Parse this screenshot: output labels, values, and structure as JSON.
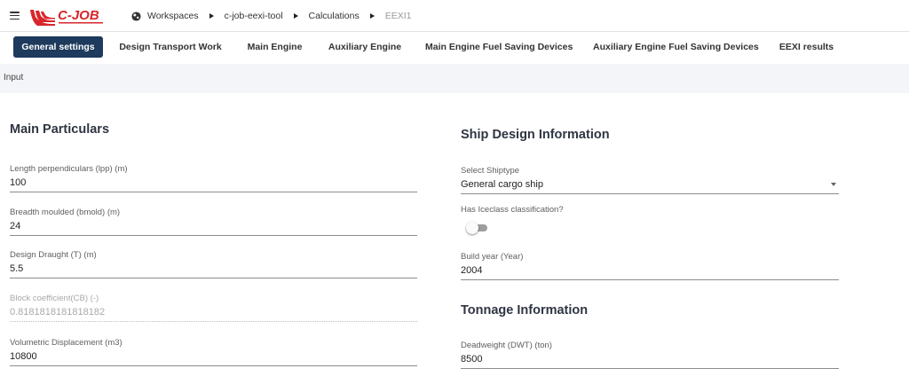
{
  "colors": {
    "tab_active_bg": "#1e3a5c",
    "logo_red": "#d7262b",
    "input_bar_bg": "#f4f5f8"
  },
  "header": {
    "menu_icon": "hamburger-icon",
    "logo_text": "C-JOB",
    "breadcrumb": {
      "workspace_icon": "globe-icon",
      "items": [
        "Workspaces",
        "c-job-eexi-tool",
        "Calculations",
        "EEXI1"
      ]
    }
  },
  "tabs": [
    {
      "label": "General settings",
      "active": true
    },
    {
      "label": "Design Transport Work",
      "active": false
    },
    {
      "label": "Main Engine",
      "active": false
    },
    {
      "label": "Auxiliary Engine",
      "active": false
    },
    {
      "label": "Main Engine Fuel Saving Devices",
      "active": false
    },
    {
      "label": "Auxiliary Engine Fuel Saving Devices",
      "active": false
    },
    {
      "label": "EEXI results",
      "active": false
    }
  ],
  "input_bar": {
    "label": "Input"
  },
  "main_particulars": {
    "title": "Main Particulars",
    "fields": [
      {
        "label": "Length perpendiculars (lpp) (m)",
        "value": "100",
        "disabled": false
      },
      {
        "label": "Breadth moulded (bmold) (m)",
        "value": "24",
        "disabled": false
      },
      {
        "label": "Design Draught (T) (m)",
        "value": "5.5",
        "disabled": false
      },
      {
        "label": "Block coefficient(CB) (-)",
        "value": "0.8181818181818182",
        "disabled": true
      },
      {
        "label": "Volumetric Displacement (m3)",
        "value": "10800",
        "disabled": false
      }
    ]
  },
  "ship_design": {
    "title": "Ship Design Information",
    "shiptype": {
      "label": "Select Shiptype",
      "value": "General cargo ship"
    },
    "iceclass": {
      "label": "Has Iceclass classification?",
      "checked": false
    },
    "build_year": {
      "label": "Build year (Year)",
      "value": "2004"
    }
  },
  "tonnage": {
    "title": "Tonnage Information",
    "deadweight": {
      "label": "Deadweight (DWT) (ton)",
      "value": "8500"
    }
  }
}
